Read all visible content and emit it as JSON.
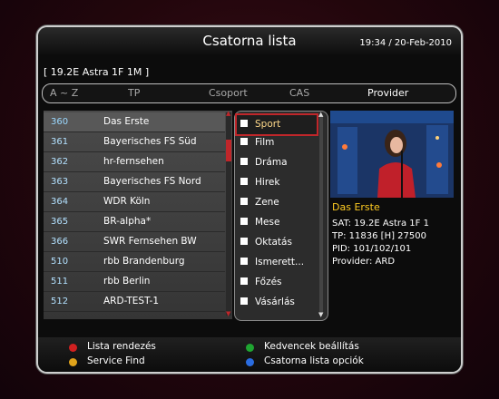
{
  "header": {
    "title": "Csatorna lista",
    "datetime": "19:34 / 20-Feb-2010"
  },
  "satellite": "[ 19.2E Astra 1F 1M ]",
  "tabs": [
    {
      "label": "A ~ Z",
      "active": false
    },
    {
      "label": "TP",
      "active": false
    },
    {
      "label": "Csoport",
      "active": false
    },
    {
      "label": "CAS",
      "active": false
    },
    {
      "label": "Provider",
      "active": true
    }
  ],
  "channels": [
    {
      "num": "360",
      "name": "Das Erste",
      "selected": true
    },
    {
      "num": "361",
      "name": "Bayerisches FS Süd"
    },
    {
      "num": "362",
      "name": "hr-fernsehen"
    },
    {
      "num": "363",
      "name": "Bayerisches FS Nord"
    },
    {
      "num": "364",
      "name": "WDR Köln"
    },
    {
      "num": "365",
      "name": "BR-alpha*"
    },
    {
      "num": "366",
      "name": "SWR Fernsehen BW"
    },
    {
      "num": "510",
      "name": "rbb Brandenburg"
    },
    {
      "num": "511",
      "name": "rbb Berlin"
    },
    {
      "num": "512",
      "name": "ARD-TEST-1"
    }
  ],
  "genres": [
    {
      "label": "Sport",
      "selected": true
    },
    {
      "label": "Film"
    },
    {
      "label": "Dráma"
    },
    {
      "label": "Hirek"
    },
    {
      "label": "Zene"
    },
    {
      "label": "Mese"
    },
    {
      "label": "Oktatás"
    },
    {
      "label": "Ismerett..."
    },
    {
      "label": "Főzés"
    },
    {
      "label": "Vásárlás"
    }
  ],
  "info": {
    "channel": "Das Erste",
    "sat": "SAT: 19.2E Astra 1F 1",
    "tp": "TP: 11836 [H] 27500",
    "pid": "PID: 101/102/101",
    "provider": "Provider: ARD"
  },
  "footer": [
    {
      "label": "Lista rendezés",
      "color": "#d02020",
      "icon": "red-key-icon"
    },
    {
      "label": "Kedvencek beállítás",
      "color": "#1fa531",
      "icon": "green-key-icon"
    },
    {
      "label": "Service Find",
      "color": "#e0a31b",
      "icon": "yellow-key-icon"
    },
    {
      "label": "Csatorna lista opciók",
      "color": "#2a6ce0",
      "icon": "blue-key-icon"
    }
  ],
  "colors": {
    "accent": "#c0262a",
    "channel_name_info": "#ffcc22",
    "channel_number": "#b3e1ff"
  }
}
